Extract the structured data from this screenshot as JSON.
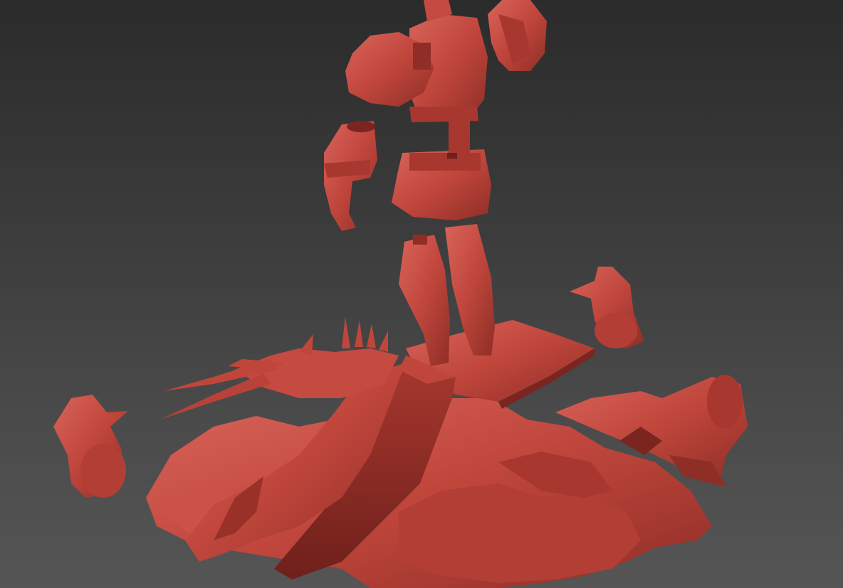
{
  "viewport": {
    "label": "",
    "background_top": "#2b2b2b",
    "background_bottom": "#555555"
  },
  "model": {
    "material_color": "#c0463c",
    "shadow_color": "#7a2520",
    "highlight_color": "#d9645a",
    "parts": [
      "knight-helmet-left",
      "knight-helmet-right",
      "knight-torso",
      "knight-arm-gauntlet",
      "knight-skirt",
      "knight-legs",
      "dragon-body",
      "dragon-wing-left",
      "dragon-wing-right",
      "rock-base",
      "broken-column",
      "cut-section-slab"
    ]
  }
}
